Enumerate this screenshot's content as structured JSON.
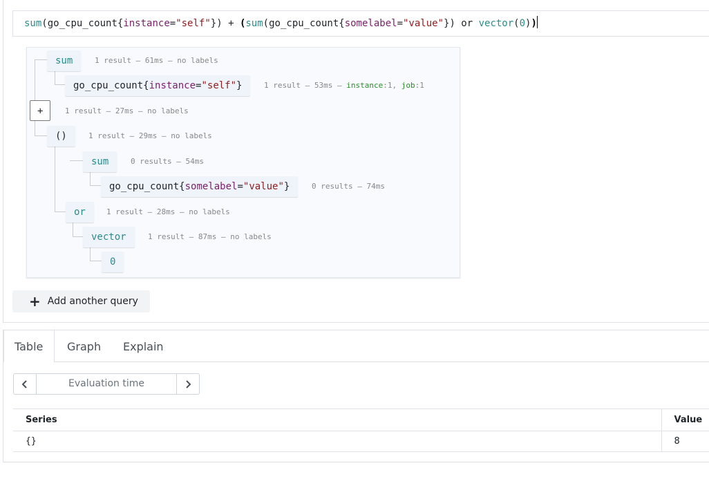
{
  "expression": {
    "tokens": [
      {
        "t": "sum",
        "c": "t-fn"
      },
      {
        "t": "(",
        "c": "t-paren"
      },
      {
        "t": "go_cpu_count",
        "c": "t-metric"
      },
      {
        "t": "{",
        "c": "t-paren"
      },
      {
        "t": "instance",
        "c": "t-label"
      },
      {
        "t": "=",
        "c": "t-op"
      },
      {
        "t": "\"self\"",
        "c": "t-str"
      },
      {
        "t": "})",
        "c": "t-paren"
      },
      {
        "t": " + ",
        "c": "t-op"
      },
      {
        "t": "(",
        "c": "t-paren-hl"
      },
      {
        "t": "sum",
        "c": "t-fn"
      },
      {
        "t": "(",
        "c": "t-paren"
      },
      {
        "t": "go_cpu_count",
        "c": "t-metric"
      },
      {
        "t": "{",
        "c": "t-paren"
      },
      {
        "t": "somelabel",
        "c": "t-label"
      },
      {
        "t": "=",
        "c": "t-op"
      },
      {
        "t": "\"value\"",
        "c": "t-str"
      },
      {
        "t": "})",
        "c": "t-paren"
      },
      {
        "t": " or ",
        "c": "t-op"
      },
      {
        "t": "vector",
        "c": "t-fn"
      },
      {
        "t": "(",
        "c": "t-paren"
      },
      {
        "t": "0",
        "c": "t-num"
      },
      {
        "t": ")",
        "c": "t-paren"
      },
      {
        "t": ")",
        "c": "t-paren-hl"
      }
    ]
  },
  "tree": {
    "sum1": {
      "label": "sum",
      "meta": "1 result — 61ms — no labels"
    },
    "selector1": {
      "metric": "go_cpu_count",
      "label_name": "instance",
      "label_value": "\"self\"",
      "meta": "1 result — 53ms — ",
      "labels": [
        {
          "k": "instance",
          "v": "1"
        },
        {
          "k": "job",
          "v": "1"
        }
      ]
    },
    "binop": {
      "label": "+",
      "meta": "1 result — 27ms — no labels"
    },
    "paren": {
      "label": "()",
      "meta": "1 result — 29ms — no labels"
    },
    "sum2": {
      "label": "sum",
      "meta": "0 results — 54ms"
    },
    "selector2": {
      "metric": "go_cpu_count",
      "label_name": "somelabel",
      "label_value": "\"value\"",
      "meta": "0 results — 74ms"
    },
    "or": {
      "label": "or",
      "meta": "1 result — 28ms — no labels"
    },
    "vector": {
      "label": "vector",
      "meta": "1 result — 87ms — no labels"
    },
    "zero": {
      "label": "0"
    }
  },
  "add_query_label": "Add another query",
  "tabs": [
    "Table",
    "Graph",
    "Explain"
  ],
  "active_tab": "Table",
  "eval_time_placeholder": "Evaluation time",
  "table": {
    "headers": {
      "series": "Series",
      "value": "Value"
    },
    "rows": [
      {
        "series": "{}",
        "value": "8"
      }
    ]
  },
  "colors": {
    "function": "#2a8c8c",
    "string": "#8f1d1d",
    "label_key": "#2a8c2a"
  }
}
